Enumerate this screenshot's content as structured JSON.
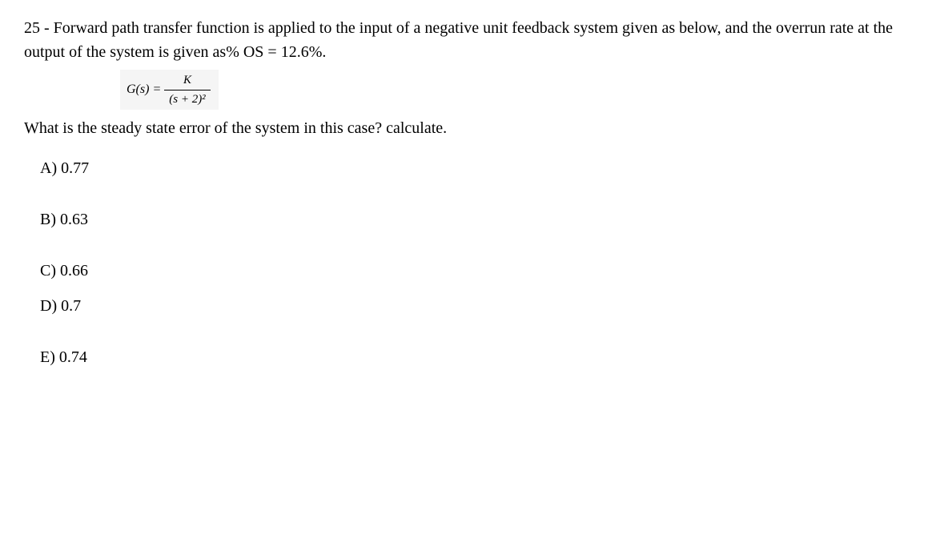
{
  "question": {
    "number": "25",
    "text_part1": "25 - Forward path transfer function is applied to the input of a negative unit feedback system given as below, and the overrun rate at the output of the system is given as% OS = 12.6%.",
    "formula_lhs": "G(s) =",
    "formula_num": "K",
    "formula_den": "(s + 2)²",
    "text_part2": "What is the steady state error of the system in this case? calculate."
  },
  "options": {
    "a": "A) 0.77",
    "b": "B) 0.63",
    "c": "C) 0.66",
    "d": "D) 0.7",
    "e": "E) 0.74"
  }
}
